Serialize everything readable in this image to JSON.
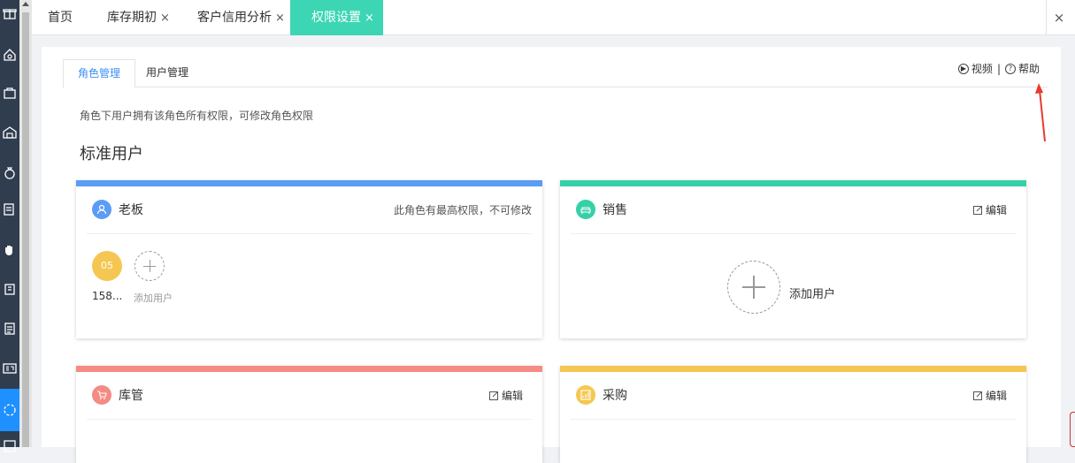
{
  "tabs": [
    {
      "label": "首页",
      "closable": false
    },
    {
      "label": "库存期初",
      "closable": true
    },
    {
      "label": "客户信用分析",
      "closable": true
    },
    {
      "label": "权限设置",
      "closable": true,
      "active": true
    }
  ],
  "tab_close_glyph": "×",
  "close_all_glyph": "×",
  "subtabs": {
    "roles": "角色管理",
    "users": "用户管理"
  },
  "help": {
    "video": "视频",
    "separator": "|",
    "help": "帮助"
  },
  "hint": "角色下用户拥有该角色所有权限，可修改角色权限",
  "section_title": "标准用户",
  "cards": {
    "boss": {
      "name": "老板",
      "note": "此角色有最高权限，不可修改",
      "color": "#5b9cf5",
      "user_badge": "05",
      "user_name": "158...",
      "add_user": "添加用户"
    },
    "sales": {
      "name": "销售",
      "edit": "编辑",
      "color": "#36d0a8",
      "add_user": "添加用户"
    },
    "warehouse": {
      "name": "库管",
      "edit": "编辑",
      "color": "#f58b84"
    },
    "purchase": {
      "name": "采购",
      "edit": "编辑",
      "color": "#f5c752"
    }
  },
  "colors": {
    "accent": "#3b8ff5",
    "active_tab": "#3cd6b4",
    "rail": "#2f3d4f",
    "annotation": "#e83a30"
  }
}
